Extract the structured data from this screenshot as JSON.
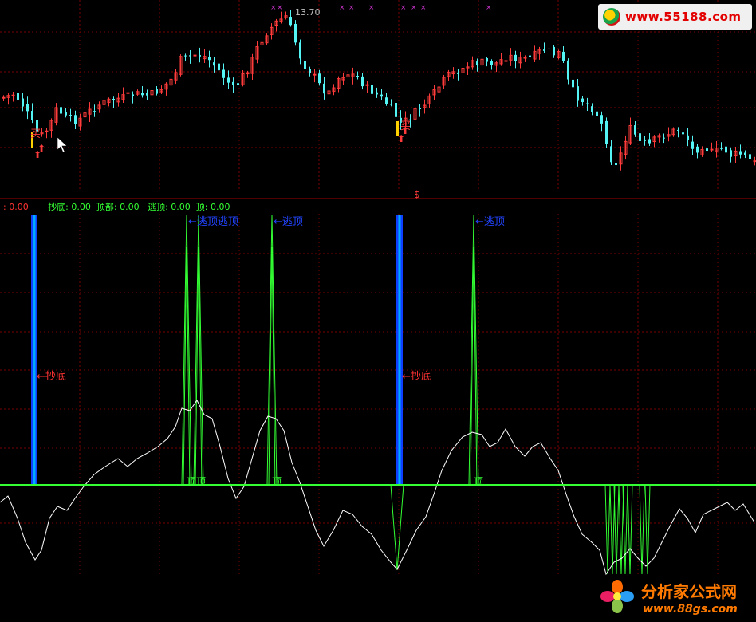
{
  "chart_data": [
    {
      "type": "candlestick",
      "panel": "price",
      "max_label": "13.70",
      "buy_marker_label": "买",
      "dollar_marker": "$",
      "colors": {
        "up": "#ff3b3b",
        "down": "#54f4f4",
        "grid": "#7a0000",
        "accent_yellow": "#ffd000",
        "marker_x": "#cc33cc"
      }
    },
    {
      "type": "line",
      "panel": "indicator",
      "legend": {
        "prefix": ": 0.00",
        "items": [
          {
            "label": "抄底: 0.00"
          },
          {
            "label": "顶部: 0.00"
          },
          {
            "label": "逃顶: 0.00"
          },
          {
            "label": "顶: 0.00"
          }
        ]
      },
      "annotations": {
        "chaodi": "←抄底",
        "taoding": "←逃顶",
        "taoding_double": "←逃顶逃顶",
        "ding": "顶",
        "ding_double": "顶顶"
      },
      "colors": {
        "line": "#ffffff",
        "zero": "#33ff33",
        "bar_blue": "#1040ff",
        "bar_cyan": "#00aaff",
        "label_red": "#ff3333",
        "label_blue": "#2244ff"
      }
    }
  ],
  "logos": {
    "top": "www.55188.com",
    "bottom_title": "分析家公式网",
    "bottom_url": "www.88gs.com"
  }
}
